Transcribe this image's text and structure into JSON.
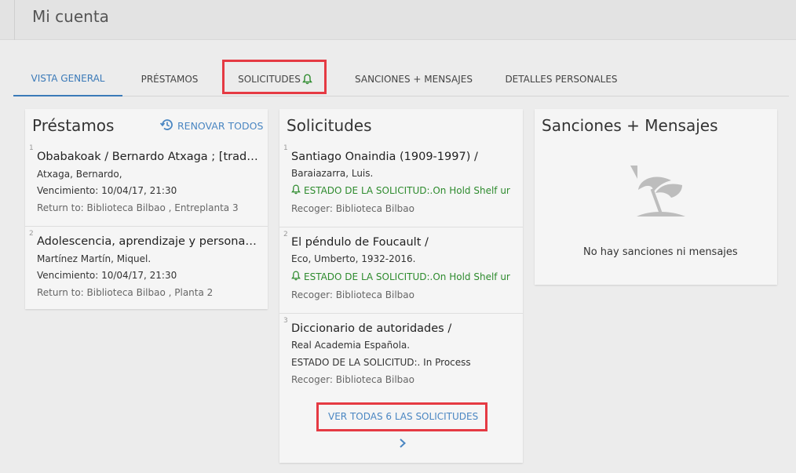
{
  "header": {
    "title": "Mi cuenta"
  },
  "tabs": [
    {
      "label": "VISTA GENERAL"
    },
    {
      "label": "PRÉSTAMOS"
    },
    {
      "label": "SOLICITUDES"
    },
    {
      "label": "SANCIONES + MENSAJES"
    },
    {
      "label": "DETALLES PERSONALES"
    }
  ],
  "loans": {
    "title": "Préstamos",
    "renew_label": "RENOVAR TODOS",
    "items": [
      {
        "index": "1",
        "title": "Obabakoak / Bernardo Atxaga ; [traducción...",
        "author": "Atxaga, Bernardo,",
        "due": "Vencimiento: 10/04/17, 21:30",
        "return_to": "Return to: Biblioteca Bilbao , Entreplanta 3"
      },
      {
        "index": "2",
        "title": "Adolescencia, aprendizaje y personalidad...",
        "author": "Martínez Martín, Miquel.",
        "due": "Vencimiento: 10/04/17, 21:30",
        "return_to": "Return to: Biblioteca Bilbao , Planta 2"
      }
    ]
  },
  "requests": {
    "title": "Solicitudes",
    "items": [
      {
        "index": "1",
        "title": "Santiago Onaindia (1909-1997) /",
        "author": "Baraiazarra, Luis.",
        "status": "ESTADO DE LA SOLICITUD:.On Hold Shelf ur",
        "status_active": true,
        "pickup": "Recoger: Biblioteca Bilbao"
      },
      {
        "index": "2",
        "title": "El péndulo de Foucault /",
        "author": "Eco, Umberto, 1932-2016.",
        "status": "ESTADO DE LA SOLICITUD:.On Hold Shelf ur",
        "status_active": true,
        "pickup": "Recoger: Biblioteca Bilbao"
      },
      {
        "index": "3",
        "title": "Diccionario de autoridades /",
        "author": "Real Academia Española.",
        "status": "ESTADO DE LA SOLICITUD:. In Process",
        "status_active": false,
        "pickup": "Recoger: Biblioteca Bilbao"
      }
    ],
    "view_all_label": "VER TODAS 6 LAS SOLICITUDES"
  },
  "fines": {
    "title": "Sanciones + Mensajes",
    "empty_text": "No hay sanciones ni mensajes"
  },
  "colors": {
    "accent": "#3b7ab8",
    "link": "#4a86c2",
    "status_green": "#2e8b2e",
    "highlight": "#e53a43"
  },
  "icons": [
    "bell-icon",
    "renew-icon",
    "chevron-right-icon",
    "beach-umbrella-icon"
  ]
}
